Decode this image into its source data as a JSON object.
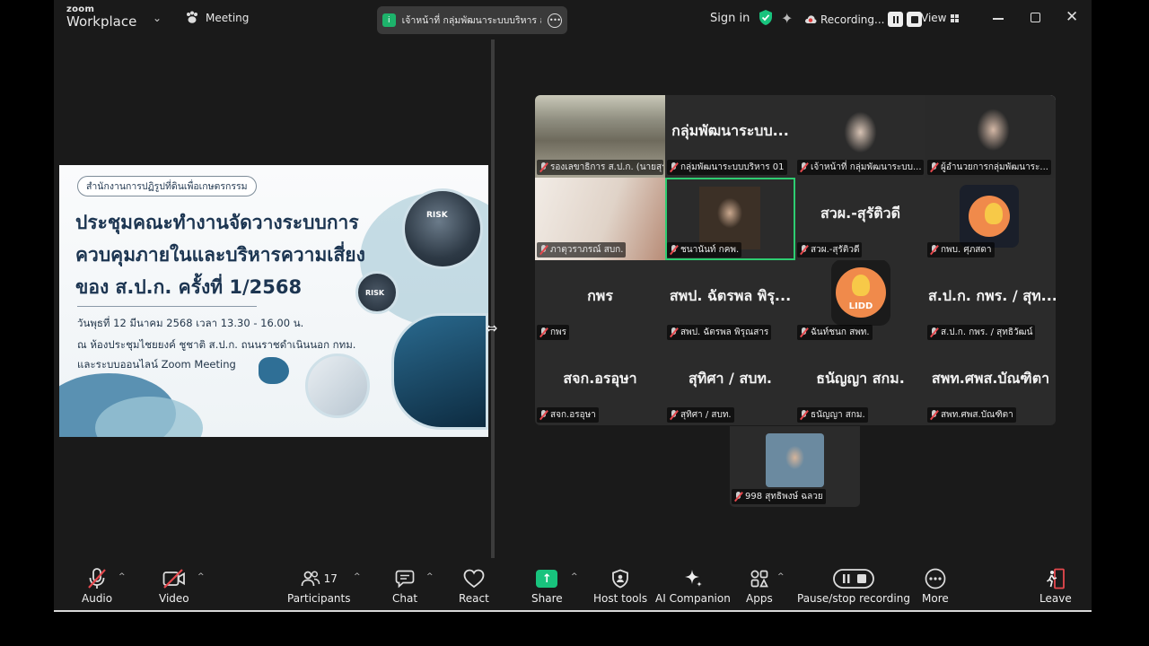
{
  "app": {
    "logo_line1": "zoom",
    "logo_line2": "Workplace",
    "meeting_label": "Meeting",
    "active_speaker_pill": "เจ้าหน้าที่ กลุ่มพัฒนาระบบบริหาร ส.ป.ก.",
    "pill_badge": "i",
    "sign_in": "Sign in",
    "recording_label": "Recording...",
    "view_label": "View"
  },
  "slide": {
    "org": "สำนักงานการปฏิรูปที่ดินเพื่อเกษตรกรรม",
    "title_line1": "ประชุมคณะทำงานจัดวางระบบการ",
    "title_line2": "ควบคุมภายในและบริหารความเสี่ยง",
    "title_line3": "ของ ส.ป.ก. ครั้งที่ 1/2568",
    "date_line": "วันพุธที่ 12 มีนาคม 2568 เวลา 13.30 - 16.00 น.",
    "place_line": "ณ ห้องประชุมไชยยงค์ ชูชาติ ส.ป.ก. ถนนราชดำเนินนอก กทม.",
    "online_line": "และระบบออนไลน์ Zoom Meeting",
    "risk_text": "RISK",
    "risk_text_small": "RISK"
  },
  "participants": [
    {
      "name": "",
      "label": "รองเลขาธิการ ส.ป.ก. (นายสุรชัย..."
    },
    {
      "name": "กลุ่มพัฒนาระบบ...",
      "label": "กลุ่มพัฒนาระบบบริหาร 01"
    },
    {
      "name": "",
      "label": "เจ้าหน้าที่ กลุ่มพัฒนาระบบ..."
    },
    {
      "name": "",
      "label": "ผู้อำนวยการกลุ่มพัฒนาระ..."
    },
    {
      "name": "",
      "label": "ภาตุวราภรณ์ สบก."
    },
    {
      "name": "",
      "label": "ชนานันท์ กคพ."
    },
    {
      "name": "สวผ.-สุรัติวดี",
      "label": "สวผ.-สุรัติวดี"
    },
    {
      "name": "",
      "label": "กพบ. ศุภสดา"
    },
    {
      "name": "กพร",
      "label": "กพร"
    },
    {
      "name": "สพป. ฉัตรพล พิรุ...",
      "label": "สพป. ฉัตรพล พิรุณสาร"
    },
    {
      "name": "",
      "label": "ฉันท์ชนก สพท."
    },
    {
      "name": "ส.ป.ก. กพร. / สุท...",
      "label": "ส.ป.ก. กพร. / สุทธิวัฒน์"
    },
    {
      "name": "สจก.อรอุษา",
      "label": "สจก.อรอุษา"
    },
    {
      "name": "สุทิศา / สบท.",
      "label": "สุทิศา / สบท."
    },
    {
      "name": "ธนัญญา สกม.",
      "label": "ธนัญญา สกม."
    },
    {
      "name": "สพท.ศพส.บัณฑิตา",
      "label": "สพท.ศพส.บัณฑิตา"
    }
  ],
  "extra_participant": {
    "label": "998 สุทธิพงษ์ ฉลวย"
  },
  "logo_tile_text": "LIDD",
  "toolbar": {
    "audio": "Audio",
    "video": "Video",
    "participants": "Participants",
    "participant_count": "17",
    "chat": "Chat",
    "react": "React",
    "share": "Share",
    "host_tools": "Host tools",
    "ai_companion": "AI Companion",
    "apps": "Apps",
    "pause_stop_recording": "Pause/stop recording",
    "more": "More",
    "leave": "Leave"
  },
  "colors": {
    "accent_green": "#18c37d",
    "mute_red": "#e5484d",
    "active_speaker_border": "#2ecc71",
    "recording_red": "#e03a3a"
  }
}
